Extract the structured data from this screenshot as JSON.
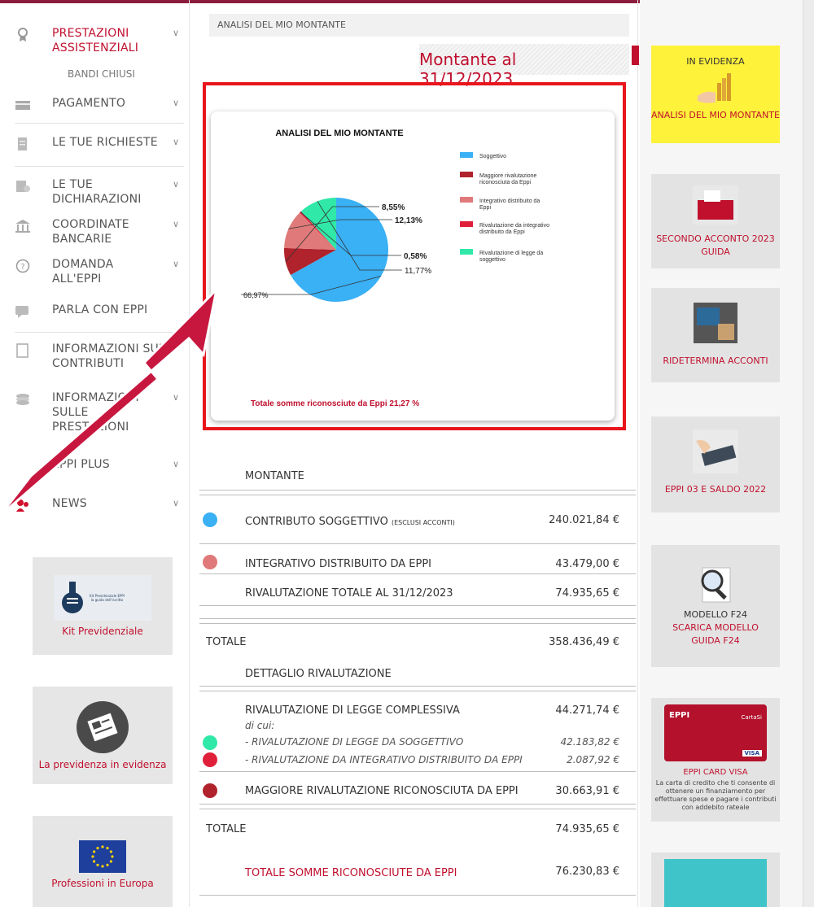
{
  "sidebar": {
    "items": [
      {
        "label": "PRESTAZIONI ASSISTENZIALI",
        "icon": "award-icon"
      },
      {
        "label": "PAGAMENTO",
        "icon": "card-icon"
      },
      {
        "label": "LE TUE RICHIESTE",
        "icon": "document-icon"
      },
      {
        "label": "LE TUE DICHIARAZIONI",
        "icon": "declaration-icon"
      },
      {
        "label": "COORDINATE BANCARIE",
        "icon": "bank-icon"
      },
      {
        "label": "DOMANDA ALL'EPPI",
        "icon": "question-icon"
      },
      {
        "label": "PARLA CON EPPI",
        "icon": "chat-icon"
      },
      {
        "label": "INFORMAZIONI SUI CONTRIBUTI",
        "icon": "info-icon"
      },
      {
        "label": "INFORMAZIONI SULLE PRESTAZIONI",
        "icon": "stack-icon"
      },
      {
        "label": "EPPI PLUS",
        "icon": "plus-icon"
      },
      {
        "label": "NEWS",
        "icon": "news-icon"
      }
    ],
    "sub_item": "BANDI CHIUSI",
    "cards": [
      {
        "caption": "Kit Previdenziale",
        "inner_title": "Kit Previdenziale EPPI",
        "inner_sub": "la guida dell'iscritto"
      },
      {
        "caption": "La previdenza in evidenza"
      },
      {
        "caption": "Professioni in Europa"
      }
    ]
  },
  "breadcrumb": "ANALISI DEL MIO MONTANTE",
  "montante_title": "Montante al 31/12/2023",
  "chart_data": {
    "type": "pie",
    "title": "ANALISI DEL MIO MONTANTE",
    "series": [
      {
        "name": "Soggettivo",
        "value": 66.97,
        "label": "66,97%",
        "color": "#3ab0f5"
      },
      {
        "name": "Maggiore rivalutazione riconosciuta da Eppi",
        "value": 8.55,
        "label": "8,55%",
        "color": "#b0222c"
      },
      {
        "name": "Integrativo distribuito da Eppi",
        "value": 12.13,
        "label": "12,13%",
        "color": "#e07a7a"
      },
      {
        "name": "Rivalutazione da integrativo distribuito da Eppi",
        "value": 0.58,
        "label": "0,58%",
        "color": "#e0203a"
      },
      {
        "name": "Rivalutazione di legge da soggettivo",
        "value": 11.77,
        "label": "11,77%",
        "color": "#30e8a8"
      }
    ],
    "footer": "Totale somme riconosciute da Eppi 21,27 %",
    "legend": "right"
  },
  "table": {
    "montante_header": "MONTANTE",
    "rows": [
      {
        "label": "CONTRIBUTO SOGGETTIVO",
        "note": "(ESCLUSI ACCONTI)",
        "value": "240.021,84 €",
        "color": "#3ab0f5"
      },
      {
        "label": "INTEGRATIVO DISTRIBUITO DA EPPI",
        "value": "43.479,00 €",
        "color": "#e07a7a"
      },
      {
        "label": "RIVALUTAZIONE TOTALE AL 31/12/2023",
        "value": "74.935,65 €"
      }
    ],
    "totale1_label": "TOTALE",
    "totale1_value": "358.436,49 €",
    "dettaglio_header": "DETTAGLIO RIVALUTAZIONE",
    "riv_legge_label": "RIVALUTAZIONE DI LEGGE COMPLESSIVA",
    "riv_legge_value": "44.271,74 €",
    "di_cui": "di cui:",
    "sub_rows": [
      {
        "label": "- RIVALUTAZIONE DI LEGGE DA SOGGETTIVO",
        "value": "42.183,82 €",
        "color": "#30e8a8"
      },
      {
        "label": "- RIVALUTAZIONE DA INTEGRATIVO DISTRIBUITO DA EPPI",
        "value": "2.087,92 €",
        "color": "#e0203a"
      }
    ],
    "maggiore_label": "MAGGIORE RIVALUTAZIONE RICONOSCIUTA DA EPPI",
    "maggiore_value": "30.663,91 €",
    "maggiore_color": "#b0222c",
    "totale2_label": "TOTALE",
    "totale2_value": "74.935,65 €",
    "somme_label": "TOTALE SOMME RICONOSCIUTE DA EPPI",
    "somme_value": "76.230,83 €"
  },
  "right": {
    "evidenza_title": "IN EVIDENZA",
    "evidenza_caption": "ANALISI DEL MIO MONTANTE",
    "cards": [
      {
        "caption": "SECONDO ACCONTO 2023 GUIDA"
      },
      {
        "caption": "RIDETERMINA ACCONTI"
      },
      {
        "caption": "EPPI 03 e SALDO 2022"
      }
    ],
    "f24_title": "MODELLO F24",
    "f24_link1": "SCARICA MODELLO",
    "f24_link2": "GUIDA F24",
    "visa_caption": "EPPI CARD VISA",
    "visa_text": "La carta di credito che ti consente di ottenere un finanziamento per effettuare spese e pagare i contributi con addebito rateale",
    "visa_card_brand": "EPPI",
    "visa_cartasi": "CartaSi",
    "visa_logo": "VISA"
  },
  "colors": {
    "accent": "#c0102e",
    "highlight_frame": "#e8161c",
    "arrow": "#c8173f",
    "evidenza_bg": "#fff23a"
  }
}
